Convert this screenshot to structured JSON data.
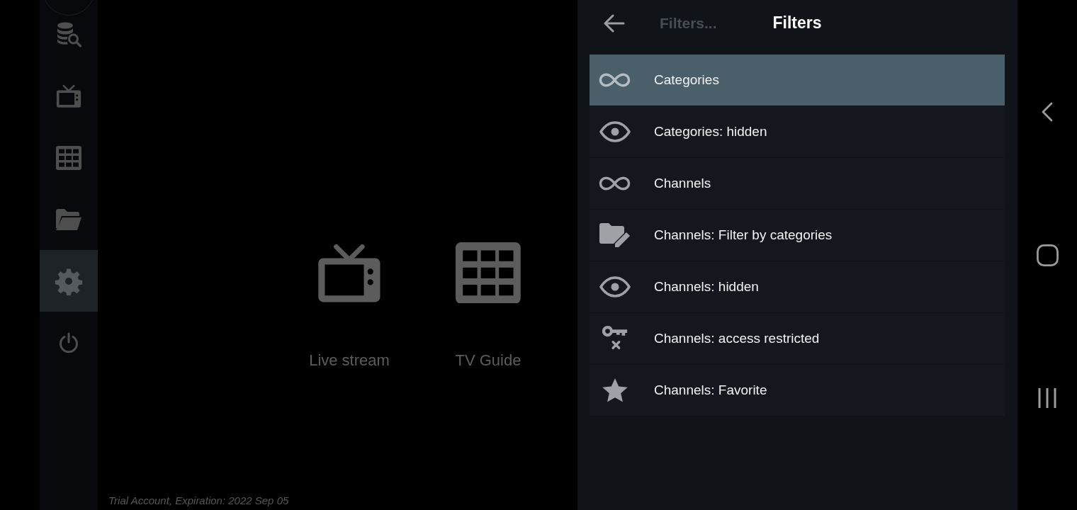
{
  "sidebar": {
    "items": [
      {
        "kind": "search",
        "selected": false
      },
      {
        "kind": "tv",
        "selected": false
      },
      {
        "kind": "grid",
        "selected": false
      },
      {
        "kind": "folder",
        "selected": false
      },
      {
        "kind": "settings",
        "selected": true
      },
      {
        "kind": "power",
        "selected": false
      }
    ]
  },
  "home_tiles": [
    {
      "kind": "tv",
      "label": "Live stream"
    },
    {
      "kind": "grid",
      "label": "TV Guide"
    }
  ],
  "account_status": "Trial Account, Expiration: 2022 Sep 05",
  "filters_panel": {
    "ghost_title": "Filters...",
    "title": "Filters",
    "items": [
      {
        "kind": "infinity",
        "label": "Categories",
        "selected": true
      },
      {
        "kind": "eye",
        "label": "Categories: hidden",
        "selected": false
      },
      {
        "kind": "infinity",
        "label": "Channels",
        "selected": false
      },
      {
        "kind": "folder-edit",
        "label": "Channels: Filter by categories",
        "selected": false
      },
      {
        "kind": "eye",
        "label": "Channels: hidden",
        "selected": false
      },
      {
        "kind": "key-off",
        "label": "Channels: access restricted",
        "selected": false
      },
      {
        "kind": "star",
        "label": "Channels: Favorite",
        "selected": false
      }
    ]
  }
}
